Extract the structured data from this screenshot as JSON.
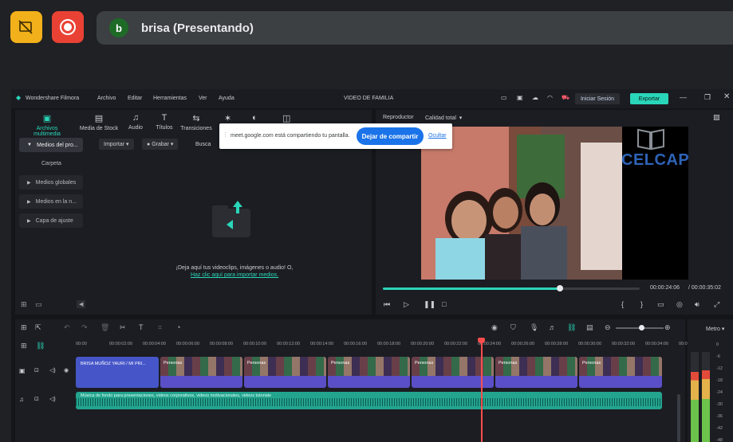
{
  "meet": {
    "presenter_initial": "b",
    "presenter_name": "brisa (Presentando)",
    "colors": {
      "cam_off_button": "#f2b11a",
      "record_button": "#e94235",
      "avatar": "#1e6b28"
    }
  },
  "filmora": {
    "app_title": "Wondershare Filmora",
    "menu": [
      "Archivo",
      "Editar",
      "Herramientas",
      "Ver",
      "Ayuda"
    ],
    "project_title": "VIDEO DE FAMILIA",
    "login_label": "Iniciar Sesión",
    "export_label": "Exportar",
    "accent": "#2ad6b9",
    "media_tabs": [
      {
        "label": "Archivos multimedia",
        "icon": "media-icon"
      },
      {
        "label": "Media de Stock",
        "icon": "stock-icon"
      },
      {
        "label": "Audio",
        "icon": "music-icon"
      },
      {
        "label": "Títulos",
        "icon": "title-icon"
      },
      {
        "label": "Transiciones",
        "icon": "transition-icon"
      }
    ],
    "sidebar": [
      {
        "label": "Medios del pro..."
      },
      {
        "label": "Carpeta"
      },
      {
        "label": "Medios globales"
      },
      {
        "label": "Medios en la n..."
      },
      {
        "label": "Capa de ajuste"
      }
    ],
    "import_label": "Importar",
    "record_label": "Grabar",
    "search_placeholder": "Busca",
    "drop_text": "¡Deja aquí tus videoclips, imágenes o audio! O,",
    "drop_link": "Haz clic aquí para importar medios.",
    "player": {
      "tab_player": "Reproductor",
      "quality": "Calidad total",
      "current_time": "00:00:24:06",
      "total_time": "/ 00:00:35:02",
      "progress": 0.69,
      "watermark": "CELCAP"
    },
    "timeline": {
      "ticks": [
        "00:00",
        "00:00:02:00",
        "00:00:04:00",
        "00:00:06:00",
        "00:00:08:00",
        "00:00:10:00",
        "00:00:12:00",
        "00:00:14:00",
        "00:00:16:00",
        "00:00:18:00",
        "00:00:20:00",
        "00:00:22:00",
        "00:00:24:00",
        "00:00:26:00",
        "00:00:28:00",
        "00:00:30:00",
        "00:00:32:00",
        "00:00:34:00",
        "00:00:3"
      ],
      "title_clip": "BRISA MUÑOZ YAURI / MI PRI...",
      "video_clip_label": "Personas",
      "audio_clip": "Música de fondo para presentaciones, videos corporativos, videos motivacionales, videos tutoriale",
      "playhead_time": "00:00:24:00"
    },
    "meter": {
      "title": "Metro",
      "db_labels": [
        "0",
        "-6",
        "-12",
        "-18",
        "-24",
        "-30",
        "-36",
        "-42",
        "-48"
      ],
      "left_level": 0.78,
      "right_level": 0.8
    }
  },
  "share_bar": {
    "message": "meet.google.com está compartiendo tu pantalla.",
    "stop_label": "Dejar de compartir",
    "hide_label": "Ocultar"
  }
}
